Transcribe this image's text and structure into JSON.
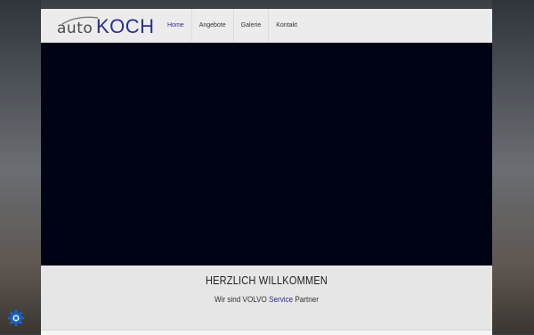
{
  "logo": {
    "auto": "auto",
    "koch": "KOCH"
  },
  "nav": {
    "items": [
      {
        "label": "Home"
      },
      {
        "label": "Angebote"
      },
      {
        "label": "Galerie"
      },
      {
        "label": "Kontakt"
      }
    ],
    "active": "Home"
  },
  "welcome": {
    "title": "HERZLICH WILLKOMMEN",
    "subtitle_pre": "Wir sind VOLVO ",
    "subtitle_highlight": "Service",
    "subtitle_post": " Partner"
  },
  "colors": {
    "brand": "#2a2f8f",
    "hero_bg": "#000314",
    "header_bg": "#ececec",
    "cookie_icon": "#1a63c7"
  },
  "icons": {
    "cookie_settings": "gear-icon"
  }
}
